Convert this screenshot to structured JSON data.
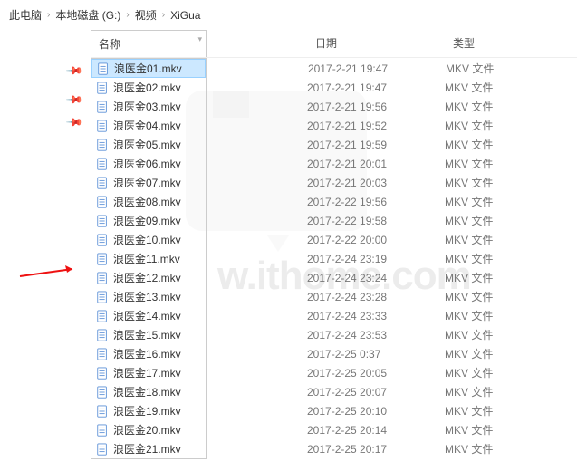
{
  "breadcrumb": {
    "items": [
      "此电脑",
      "本地磁盘 (G:)",
      "视频",
      "XiGua"
    ]
  },
  "columns": {
    "name": "名称",
    "date": "日期",
    "type": "类型"
  },
  "watermark": "w.ithome.com",
  "files": [
    {
      "name": "浪医金01.mkv",
      "date": "2017-2-21 19:47",
      "type": "MKV 文件",
      "selected": true
    },
    {
      "name": "浪医金02.mkv",
      "date": "2017-2-21 19:47",
      "type": "MKV 文件",
      "selected": false
    },
    {
      "name": "浪医金03.mkv",
      "date": "2017-2-21 19:56",
      "type": "MKV 文件",
      "selected": false
    },
    {
      "name": "浪医金04.mkv",
      "date": "2017-2-21 19:52",
      "type": "MKV 文件",
      "selected": false
    },
    {
      "name": "浪医金05.mkv",
      "date": "2017-2-21 19:59",
      "type": "MKV 文件",
      "selected": false
    },
    {
      "name": "浪医金06.mkv",
      "date": "2017-2-21 20:01",
      "type": "MKV 文件",
      "selected": false
    },
    {
      "name": "浪医金07.mkv",
      "date": "2017-2-21 20:03",
      "type": "MKV 文件",
      "selected": false
    },
    {
      "name": "浪医金08.mkv",
      "date": "2017-2-22 19:56",
      "type": "MKV 文件",
      "selected": false
    },
    {
      "name": "浪医金09.mkv",
      "date": "2017-2-22 19:58",
      "type": "MKV 文件",
      "selected": false
    },
    {
      "name": "浪医金10.mkv",
      "date": "2017-2-22 20:00",
      "type": "MKV 文件",
      "selected": false
    },
    {
      "name": "浪医金11.mkv",
      "date": "2017-2-24 23:19",
      "type": "MKV 文件",
      "selected": false
    },
    {
      "name": "浪医金12.mkv",
      "date": "2017-2-24 23:24",
      "type": "MKV 文件",
      "selected": false
    },
    {
      "name": "浪医金13.mkv",
      "date": "2017-2-24 23:28",
      "type": "MKV 文件",
      "selected": false
    },
    {
      "name": "浪医金14.mkv",
      "date": "2017-2-24 23:33",
      "type": "MKV 文件",
      "selected": false
    },
    {
      "name": "浪医金15.mkv",
      "date": "2017-2-24 23:53",
      "type": "MKV 文件",
      "selected": false
    },
    {
      "name": "浪医金16.mkv",
      "date": "2017-2-25 0:37",
      "type": "MKV 文件",
      "selected": false
    },
    {
      "name": "浪医金17.mkv",
      "date": "2017-2-25 20:05",
      "type": "MKV 文件",
      "selected": false
    },
    {
      "name": "浪医金18.mkv",
      "date": "2017-2-25 20:07",
      "type": "MKV 文件",
      "selected": false
    },
    {
      "name": "浪医金19.mkv",
      "date": "2017-2-25 20:10",
      "type": "MKV 文件",
      "selected": false
    },
    {
      "name": "浪医金20.mkv",
      "date": "2017-2-25 20:14",
      "type": "MKV 文件",
      "selected": false
    },
    {
      "name": "浪医金21.mkv",
      "date": "2017-2-25 20:17",
      "type": "MKV 文件",
      "selected": false
    }
  ]
}
